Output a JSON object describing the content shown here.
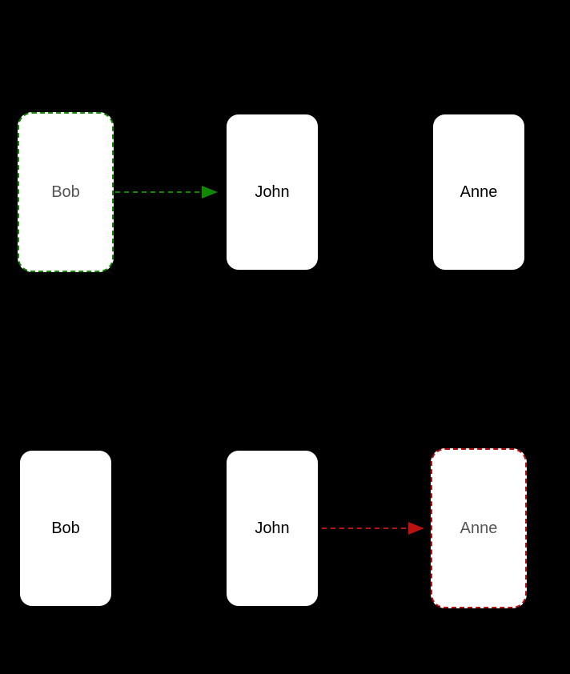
{
  "rows": {
    "top": {
      "node1": {
        "label": "Bob",
        "style": "dashed-green"
      },
      "node2": {
        "label": "John",
        "style": "solid"
      },
      "node3": {
        "label": "Anne",
        "style": "solid"
      },
      "arrow": {
        "from": 1,
        "to": 2,
        "color": "#118800"
      }
    },
    "bottom": {
      "node1": {
        "label": "Bob",
        "style": "solid"
      },
      "node2": {
        "label": "John",
        "style": "solid"
      },
      "node3": {
        "label": "Anne",
        "style": "dashed-red"
      },
      "arrow": {
        "from": 2,
        "to": 3,
        "color": "#bb1111"
      }
    }
  },
  "layout": {
    "colX": [
      22,
      280,
      538
    ],
    "rowY": [
      140,
      560
    ],
    "nodeW": 120,
    "nodeH": 200
  }
}
